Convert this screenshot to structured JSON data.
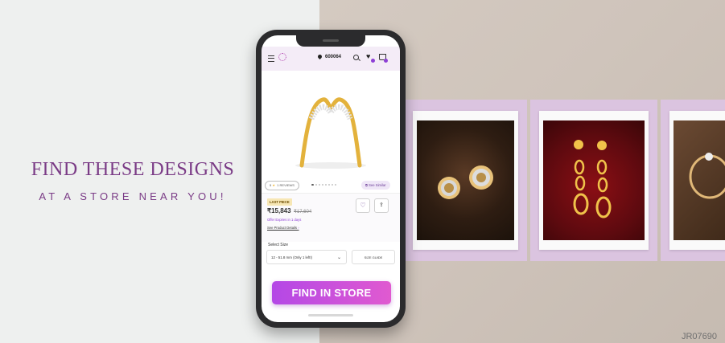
{
  "headline": {
    "line1": "FIND THESE DESIGNS",
    "line2": "AT A STORE NEAR YOU!"
  },
  "watermark": "JR07690",
  "phone": {
    "header": {
      "pincode": "600064",
      "wishlist_badge_color": "#8e3fd6",
      "cart_badge_color": "#8e3fd6"
    },
    "product": {
      "rating": "5",
      "reviews": "1 REVIEWS",
      "see_similar": "See Similar",
      "tag": "LAST PIECE",
      "price": "₹15,843",
      "mrp": "₹17,604",
      "offer": "Offer Expires in 1 days",
      "details_link": "See Product Details"
    },
    "size": {
      "label": "Select Size",
      "selected": "12 - 51.8 mm",
      "note": "(Only 1 left!)",
      "guide": "SIZE GUIDE"
    },
    "cta": "FIND IN STORE",
    "gallery_dots": 8
  },
  "colors": {
    "accent_purple": "#7a3b86",
    "cta_start": "#b448e6",
    "cta_end": "#e05ad0",
    "frame_lilac": "#dbc4e0"
  },
  "icons": [
    "menu-icon",
    "logo-icon",
    "location-pin-icon",
    "search-icon",
    "heart-icon",
    "cart-icon",
    "star-icon",
    "share-icon",
    "chevron-down-icon"
  ]
}
